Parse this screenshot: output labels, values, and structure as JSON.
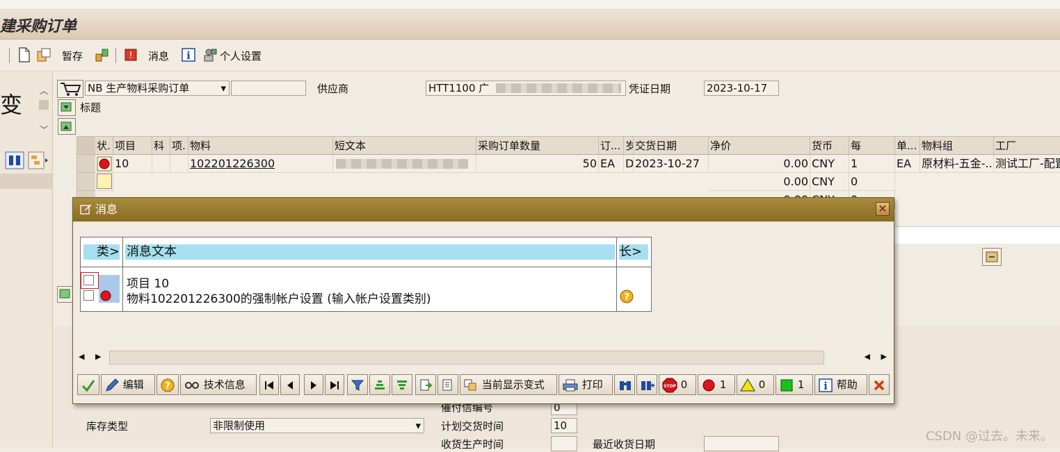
{
  "window": {
    "title_partial": "建采购订单"
  },
  "toolbar": {
    "hold_label": "暂存",
    "messages_label": "消息",
    "personal_settings_label": "个人设置"
  },
  "left_pane": {
    "partial_text": "变"
  },
  "header": {
    "doc_type": "NB 生产物料采购订单",
    "vendor_label": "供应商",
    "vendor_value": "HTT1100 广",
    "doc_date_label": "凭证日期",
    "doc_date_value": "2023-10-17",
    "header_section_label": "标题"
  },
  "item_table": {
    "columns": [
      "状.",
      "项目",
      "科",
      "项.",
      "物料",
      "短文本",
      "采购订单数量",
      "订...",
      "岁",
      "交货日期",
      "净价",
      "货币",
      "每",
      "单...",
      "物料组",
      "工厂"
    ],
    "rows": [
      {
        "status": "red",
        "item": "10",
        "material": "102201226300",
        "qty": "50",
        "unit": "EA",
        "cat": "D",
        "delivery_date": "2023-10-27",
        "net_price": "0.00",
        "currency": "CNY",
        "per": "1",
        "order_unit": "EA",
        "mat_group": "原材料-五金-...",
        "plant": "测试工厂-配置"
      },
      {
        "status": "empty",
        "item": "",
        "material": "",
        "qty": "",
        "unit": "",
        "cat": "",
        "delivery_date": "",
        "net_price": "0.00",
        "currency": "CNY",
        "per": "0",
        "order_unit": "",
        "mat_group": "",
        "plant": ""
      },
      {
        "status": "",
        "item": "",
        "material": "",
        "qty": "",
        "unit": "",
        "cat": "",
        "delivery_date": "",
        "net_price": "0.00",
        "currency": "CNY",
        "per": "0",
        "order_unit": "",
        "mat_group": "",
        "plant": ""
      }
    ]
  },
  "lower": {
    "stock_type_label": "库存类型",
    "stock_type_value": "非限制使用",
    "reminder_label": "催付信编号",
    "reminder_value": "0",
    "planned_delivery_label": "计划交货时间",
    "planned_delivery_value": "10",
    "gr_processing_label": "收货生产时间",
    "last_gr_label": "最近收货日期"
  },
  "dialog": {
    "title": "消息",
    "col_type": "类>",
    "col_text": "消息文本",
    "col_long": "长>",
    "messages": [
      {
        "text": "项目 10",
        "type": ""
      },
      {
        "text": "物料102201226300的强制帐户设置 (输入帐户设置类别)",
        "type": "error"
      }
    ],
    "buttons": {
      "edit": "编辑",
      "tech_info": "技术信息",
      "current_layout": "当前显示变式",
      "print": "打印",
      "stop_count": "0",
      "error_count": "1",
      "warning_count": "0",
      "success_count": "1",
      "help": "帮助"
    }
  },
  "watermark": "CSDN @过去。未来。",
  "colors": {
    "title_bar": "#8a6d22",
    "header_highlight": "#a7dff0",
    "error_red": "#e0141e"
  }
}
